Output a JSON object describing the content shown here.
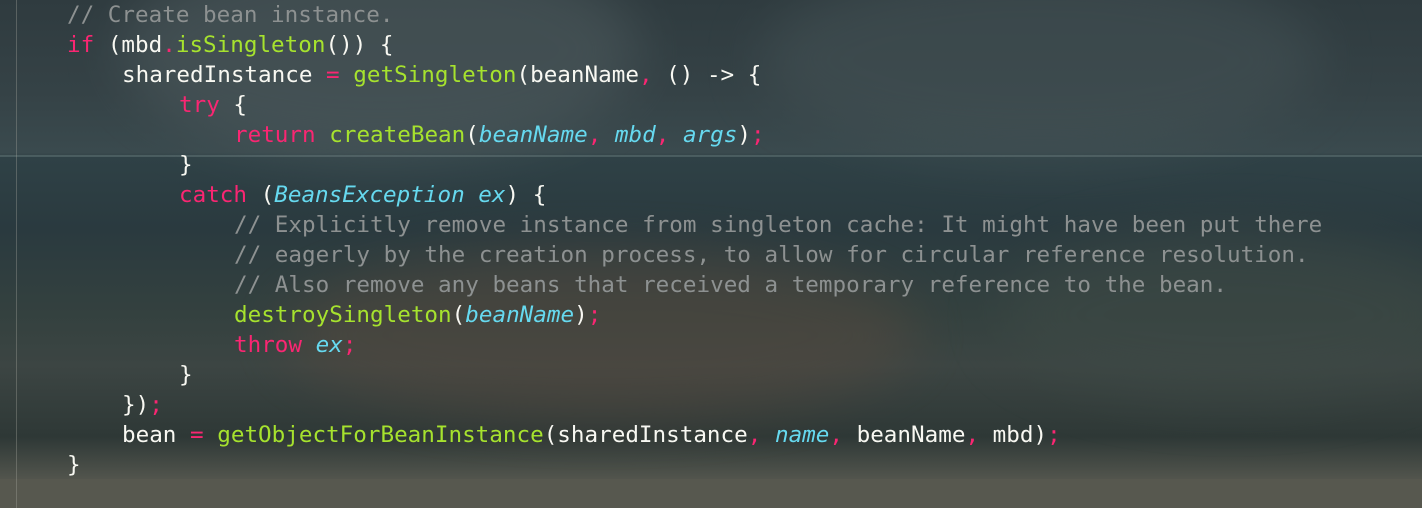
{
  "lines": [
    {
      "indent": 0,
      "tokens": [
        {
          "t": "comment",
          "v": "// Create bean instance."
        }
      ]
    },
    {
      "indent": 0,
      "tokens": [
        {
          "t": "keyword",
          "v": "if"
        },
        {
          "t": "text",
          "v": " (mbd"
        },
        {
          "t": "operator",
          "v": "."
        },
        {
          "t": "function",
          "v": "isSingleton"
        },
        {
          "t": "text",
          "v": "()) {"
        }
      ]
    },
    {
      "indent": 1,
      "tokens": [
        {
          "t": "text",
          "v": "sharedInstance "
        },
        {
          "t": "operator",
          "v": "="
        },
        {
          "t": "text",
          "v": " "
        },
        {
          "t": "function",
          "v": "getSingleton"
        },
        {
          "t": "text",
          "v": "(beanName"
        },
        {
          "t": "operator",
          "v": ","
        },
        {
          "t": "text",
          "v": " () -> {"
        }
      ]
    },
    {
      "indent": 2,
      "tokens": [
        {
          "t": "keyword",
          "v": "try"
        },
        {
          "t": "text",
          "v": " {"
        }
      ]
    },
    {
      "indent": 3,
      "tokens": [
        {
          "t": "keyword",
          "v": "return"
        },
        {
          "t": "text",
          "v": " "
        },
        {
          "t": "function",
          "v": "createBean"
        },
        {
          "t": "text",
          "v": "("
        },
        {
          "t": "param",
          "v": "beanName"
        },
        {
          "t": "operator",
          "v": ","
        },
        {
          "t": "text",
          "v": " "
        },
        {
          "t": "param",
          "v": "mbd"
        },
        {
          "t": "operator",
          "v": ","
        },
        {
          "t": "text",
          "v": " "
        },
        {
          "t": "param",
          "v": "args"
        },
        {
          "t": "text",
          "v": ")"
        },
        {
          "t": "operator",
          "v": ";"
        }
      ]
    },
    {
      "indent": 2,
      "tokens": [
        {
          "t": "text",
          "v": "}"
        }
      ]
    },
    {
      "indent": 2,
      "tokens": [
        {
          "t": "keyword",
          "v": "catch"
        },
        {
          "t": "text",
          "v": " ("
        },
        {
          "t": "type",
          "v": "BeansException"
        },
        {
          "t": "text",
          "v": " "
        },
        {
          "t": "param",
          "v": "ex"
        },
        {
          "t": "text",
          "v": ") {"
        }
      ]
    },
    {
      "indent": 3,
      "tokens": [
        {
          "t": "comment",
          "v": "// Explicitly remove instance from singleton cache: It might have been put there"
        }
      ]
    },
    {
      "indent": 3,
      "tokens": [
        {
          "t": "comment",
          "v": "// eagerly by the creation process, to allow for circular reference resolution."
        }
      ]
    },
    {
      "indent": 3,
      "tokens": [
        {
          "t": "comment",
          "v": "// Also remove any beans that received a temporary reference to the bean."
        }
      ]
    },
    {
      "indent": 3,
      "tokens": [
        {
          "t": "function",
          "v": "destroySingleton"
        },
        {
          "t": "text",
          "v": "("
        },
        {
          "t": "param",
          "v": "beanName"
        },
        {
          "t": "text",
          "v": ")"
        },
        {
          "t": "operator",
          "v": ";"
        }
      ]
    },
    {
      "indent": 3,
      "tokens": [
        {
          "t": "keyword",
          "v": "throw"
        },
        {
          "t": "text",
          "v": " "
        },
        {
          "t": "param",
          "v": "ex"
        },
        {
          "t": "operator",
          "v": ";"
        }
      ]
    },
    {
      "indent": 2,
      "tokens": [
        {
          "t": "text",
          "v": "}"
        }
      ]
    },
    {
      "indent": 1,
      "tokens": [
        {
          "t": "text",
          "v": "})"
        },
        {
          "t": "operator",
          "v": ";"
        }
      ]
    },
    {
      "indent": 1,
      "tokens": [
        {
          "t": "text",
          "v": "bean "
        },
        {
          "t": "operator",
          "v": "="
        },
        {
          "t": "text",
          "v": " "
        },
        {
          "t": "function",
          "v": "getObjectForBeanInstance"
        },
        {
          "t": "text",
          "v": "(sharedInstance"
        },
        {
          "t": "operator",
          "v": ","
        },
        {
          "t": "text",
          "v": " "
        },
        {
          "t": "param",
          "v": "name"
        },
        {
          "t": "operator",
          "v": ","
        },
        {
          "t": "text",
          "v": " beanName"
        },
        {
          "t": "operator",
          "v": ","
        },
        {
          "t": "text",
          "v": " mbd)"
        },
        {
          "t": "operator",
          "v": ";"
        }
      ]
    },
    {
      "indent": 0,
      "tokens": [
        {
          "t": "text",
          "v": "}"
        }
      ]
    }
  ],
  "theme": {
    "comment": "#8d9191",
    "keyword": "#f92672",
    "function": "#a6e22e",
    "param": "#66d9ef",
    "type": "#66d9ef",
    "operator": "#f92672",
    "text": "#f8f8f2"
  }
}
